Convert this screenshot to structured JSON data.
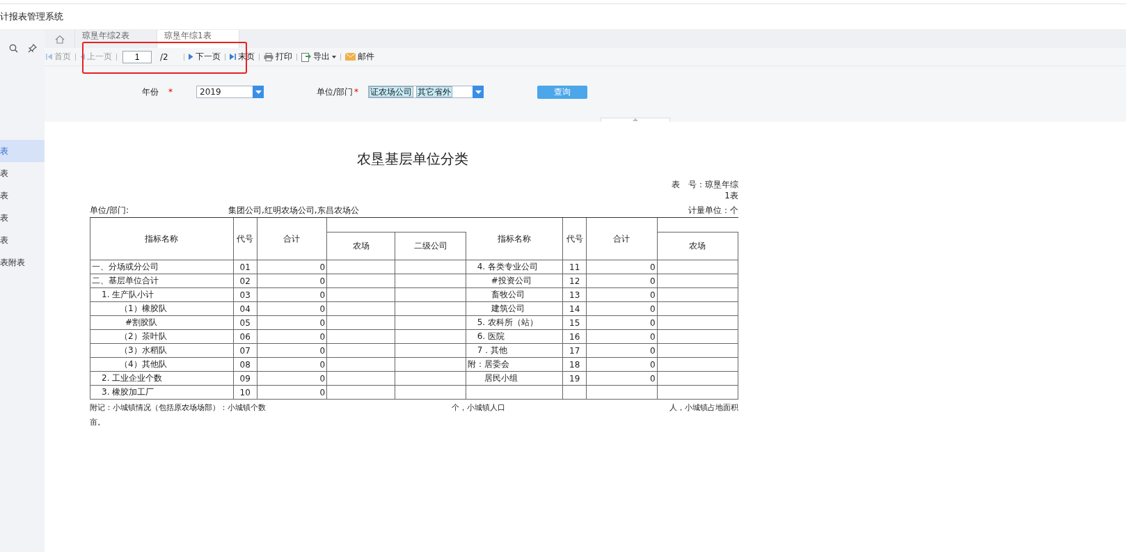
{
  "header": {
    "title": "计报表管理系统"
  },
  "sidebar": {
    "items": [
      {
        "label": "表",
        "selected": true
      },
      {
        "label": "表",
        "selected": false
      },
      {
        "label": "表",
        "selected": false
      },
      {
        "label": "表",
        "selected": false
      },
      {
        "label": "表",
        "selected": false
      },
      {
        "label": "表附表",
        "selected": false
      }
    ]
  },
  "tabs": [
    {
      "kind": "home",
      "selected": false
    },
    {
      "kind": "text",
      "label": "琼垦年综2表",
      "selected": false
    },
    {
      "kind": "text",
      "label": "琼垦年综1表",
      "selected": true
    }
  ],
  "toolbar": [
    {
      "kind": "first",
      "label": "首页",
      "disabled": true
    },
    {
      "kind": "prev",
      "label": "上一页",
      "disabled": true
    },
    {
      "kind": "page",
      "value": "1",
      "total": "/2"
    },
    {
      "kind": "next",
      "label": "下一页",
      "disabled": false
    },
    {
      "kind": "last",
      "label": "末页",
      "disabled": false
    },
    {
      "kind": "print",
      "label": "打印",
      "disabled": false
    },
    {
      "kind": "export",
      "label": "导出",
      "disabled": false
    },
    {
      "kind": "mail",
      "label": "邮件",
      "disabled": false
    }
  ],
  "filters": {
    "year_label": "年份",
    "year_required": "*",
    "year_value": "2019",
    "unit_label": "单位/部门",
    "unit_required": "*",
    "unit_tags": [
      "证农场公司",
      "其它省外"
    ],
    "query_button": "查询"
  },
  "report": {
    "title": "农垦基层单位分类",
    "table_no": [
      "表　号：琼垦年综",
      "1表"
    ],
    "unit_label": "单位/部门:",
    "unit_value": "集团公司,红明农场公司,东昌农场公",
    "measure": "计量单位：个",
    "columns_left": [
      "指标名称",
      "代号",
      "合计",
      "农场",
      "二级公司"
    ],
    "columns_right": [
      "指标名称",
      "代号",
      "合计",
      "农场"
    ],
    "rows": [
      {
        "left": {
          "name": "一、分场或分公司",
          "kind": "top",
          "code": "01",
          "total": "0"
        },
        "right": {
          "name": "4. 各类专业公司",
          "kind": "mid",
          "code": "11",
          "total": "0"
        }
      },
      {
        "left": {
          "name": "二、基层单位合计",
          "kind": "top",
          "code": "02",
          "total": "0"
        },
        "right": {
          "name": "#投资公司",
          "kind": "deep",
          "code": "12",
          "total": "0"
        }
      },
      {
        "left": {
          "name": "1. 生产队小计",
          "kind": "sub",
          "code": "03",
          "total": "0"
        },
        "right": {
          "name": "畜牧公司",
          "kind": "deep",
          "code": "13",
          "total": "0"
        }
      },
      {
        "left": {
          "name": "（1）橡胶队",
          "kind": "leaf",
          "code": "04",
          "total": "0"
        },
        "right": {
          "name": "建筑公司",
          "kind": "deep",
          "code": "14",
          "total": "0"
        }
      },
      {
        "left": {
          "name": "#割胶队",
          "kind": "detail",
          "code": "05",
          "total": "0"
        },
        "right": {
          "name": "5. 农科所（站）",
          "kind": "mid",
          "code": "15",
          "total": "0"
        }
      },
      {
        "left": {
          "name": "（2）茶叶队",
          "kind": "leaf",
          "code": "06",
          "total": "0"
        },
        "right": {
          "name": "6. 医院",
          "kind": "mid",
          "code": "16",
          "total": "0"
        }
      },
      {
        "left": {
          "name": "（3）水稻队",
          "kind": "leaf",
          "code": "07",
          "total": "0"
        },
        "right": {
          "name": "7．其他",
          "kind": "mid",
          "code": "17",
          "total": "0"
        }
      },
      {
        "left": {
          "name": "（4）其他队",
          "kind": "leaf",
          "code": "08",
          "total": "0"
        },
        "right": {
          "name": "附：居委会",
          "kind": "top",
          "code": "18",
          "total": "0"
        }
      },
      {
        "left": {
          "name": "2. 工业企业个数",
          "kind": "sub",
          "code": "09",
          "total": "0"
        },
        "right": {
          "name": "居民小组",
          "kind": "sub2",
          "code": "19",
          "total": "0"
        }
      },
      {
        "left": {
          "name": "3. 橡胶加工厂",
          "kind": "sub",
          "code": "10",
          "total": "0"
        },
        "right": {}
      }
    ],
    "notes": [
      "附记：小城镇情况（包括原农场场部）：小城镇个数",
      "个，小城镇人口",
      "人，小城镇占地面积"
    ],
    "notes_end": "亩。"
  }
}
